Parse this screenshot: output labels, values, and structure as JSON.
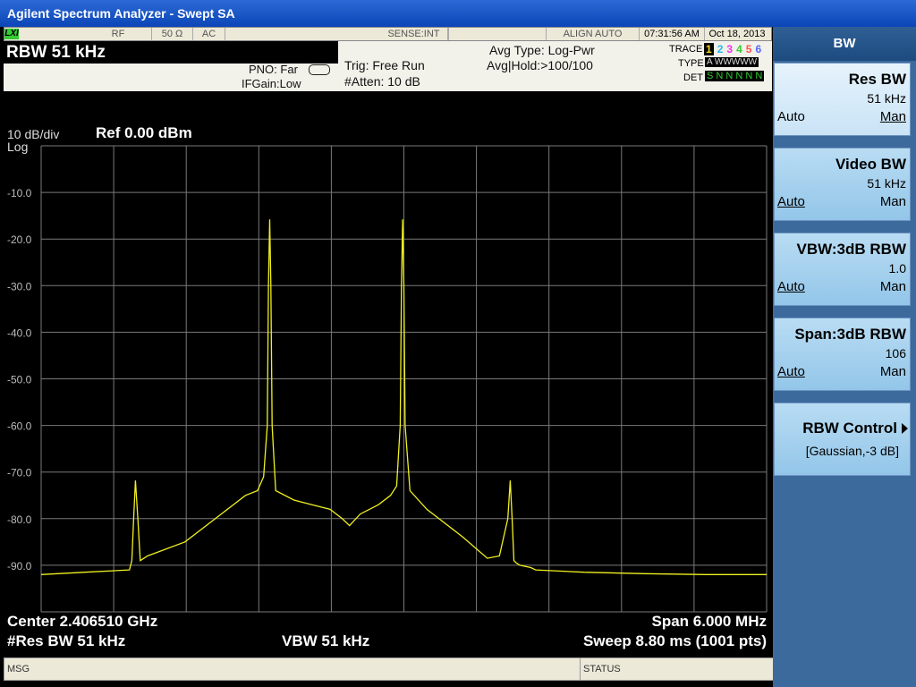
{
  "window": {
    "title": "Agilent Spectrum Analyzer - Swept SA"
  },
  "status_bar": {
    "lxi": "LXI",
    "rf": "RF",
    "impedance": "50 Ω",
    "coupling": "AC",
    "sense": "SENSE:INT",
    "align": "ALIGN AUTO",
    "time": "07:31:56 AM",
    "date": "Oct 18, 2013"
  },
  "header": {
    "rbw": "RBW  51 kHz",
    "pno": "PNO: Far",
    "ifgain": "IFGain:Low",
    "trig": "Trig: Free Run",
    "atten": "#Atten: 10 dB",
    "avg_type": "Avg Type: Log-Pwr",
    "avg_hold": "Avg|Hold:>100/100",
    "trace_label": "TRACE",
    "type_label": "TYPE",
    "det_label": "DET",
    "trace_numbers": [
      "1",
      "2",
      "3",
      "4",
      "5",
      "6"
    ],
    "trace_types": "A WWWWW",
    "det_values": "S N N N N N",
    "trace_colors": [
      "#f0e020",
      "#22bbee",
      "#ee33ee",
      "#33cc33",
      "#ff5555",
      "#5566ff"
    ]
  },
  "plot": {
    "scale": "10 dB/div",
    "scale_type": "Log",
    "ref": "Ref 0.00 dBm",
    "center": "Center 2.406510 GHz",
    "res_bw": "#Res BW 51 kHz",
    "vbw": "VBW 51 kHz",
    "span": "Span 6.000 MHz",
    "sweep": "Sweep  8.80 ms (1001 pts)"
  },
  "chart_data": {
    "type": "line",
    "series": [
      {
        "x": [
          2403.51,
          2403.87,
          2404.24,
          2404.26,
          2404.275,
          2404.29,
          2404.31,
          2404.33,
          2404.36,
          2404.39,
          2404.7,
          2405.0,
          2405.2,
          2405.3,
          2405.35,
          2405.38,
          2405.39,
          2405.4,
          2405.41,
          2405.42,
          2405.45,
          2405.6,
          2405.75,
          2405.9,
          2406.0,
          2406.06,
          2406.15,
          2406.3,
          2406.4,
          2406.45,
          2406.48,
          2406.49,
          2406.5,
          2406.51,
          2406.52,
          2406.56,
          2406.7,
          2406.85,
          2407.0,
          2407.2,
          2407.3,
          2407.37,
          2407.39,
          2407.405,
          2407.42,
          2407.44,
          2407.47,
          2407.56,
          2407.6,
          2408.0,
          2408.5,
          2409.0,
          2409.51
        ],
        "y": [
          -92.0,
          -91.5,
          -91.0,
          -89.0,
          -80.0,
          -71.8,
          -80.0,
          -89.0,
          -88.5,
          -88.0,
          -85.0,
          -79.0,
          -75.0,
          -74.0,
          -71.0,
          -60.0,
          -30.0,
          -15.8,
          -30.0,
          -60.0,
          -74.0,
          -76.0,
          -77.0,
          -78.0,
          -80.0,
          -81.5,
          -79.0,
          -77.0,
          -75.0,
          -73.0,
          -60.0,
          -30.0,
          -15.8,
          -30.0,
          -60.0,
          -74.0,
          -78.0,
          -81.0,
          -84.0,
          -88.5,
          -88.0,
          -80.0,
          -71.8,
          -80.0,
          -89.0,
          -89.5,
          -90.0,
          -90.5,
          -91.0,
          -91.5,
          -91.8,
          -92.0,
          -92.0
        ]
      }
    ],
    "xlim": [
      2403.51,
      2409.51
    ],
    "ylim": [
      -100,
      0
    ],
    "yticks": [
      -10,
      -20,
      -30,
      -40,
      -50,
      -60,
      -70,
      -80,
      -90
    ],
    "ytick_labels": [
      "-10.0",
      "-20.0",
      "-30.0",
      "-40.0",
      "-50.0",
      "-60.0",
      "-70.0",
      "-80.0",
      "-90.0"
    ],
    "grid": true,
    "trace_color": "#f0f020",
    "grid_color": "#7a7a7a"
  },
  "softkeys": {
    "title": "BW",
    "keys": [
      {
        "label": "Res BW",
        "value": "51 kHz",
        "auto": "Auto",
        "man": "Man",
        "active": "man"
      },
      {
        "label": "Video BW",
        "value": "51 kHz",
        "auto": "Auto",
        "man": "Man",
        "active": "auto"
      },
      {
        "label": "VBW:3dB RBW",
        "value": "1.0",
        "auto": "Auto",
        "man": "Man",
        "active": "auto"
      },
      {
        "label": "Span:3dB RBW",
        "value": "106",
        "auto": "Auto",
        "man": "Man",
        "active": "auto"
      },
      {
        "label": "RBW Control",
        "value": "[Gaussian,-3 dB]"
      }
    ]
  },
  "bottom": {
    "msg": "MSG",
    "status": "STATUS"
  }
}
